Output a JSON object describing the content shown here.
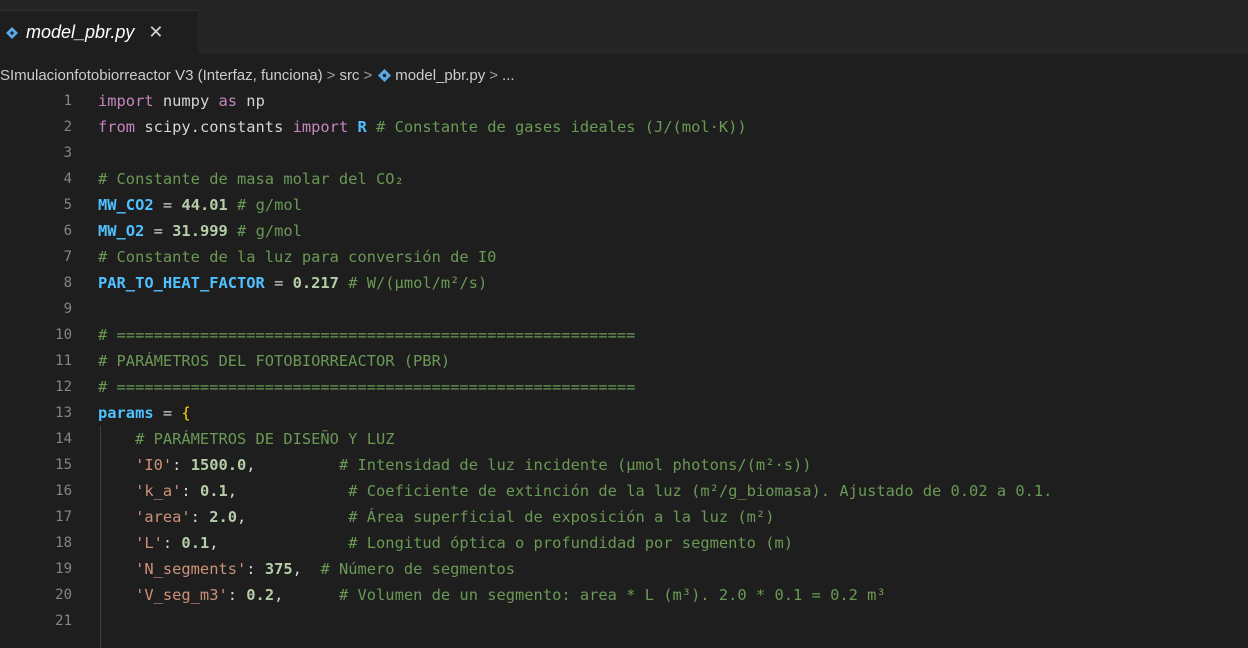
{
  "tab": {
    "label": "model_pbr.py",
    "close": "✕"
  },
  "breadcrumb": {
    "items": [
      "SImulacionfotobiorreactor V3 (Interfaz, funciona)",
      "src",
      "model_pbr.py",
      "..."
    ],
    "separator": ">"
  },
  "editor": {
    "lines": [
      {
        "n": "1",
        "segs": [
          [
            "kw",
            "import"
          ],
          [
            "wt",
            " numpy "
          ],
          [
            "kw",
            "as"
          ],
          [
            "wt",
            " np"
          ]
        ]
      },
      {
        "n": "2",
        "segs": [
          [
            "kw",
            "from"
          ],
          [
            "wt",
            " scipy.constants "
          ],
          [
            "kw",
            "import"
          ],
          [
            "var",
            " R"
          ],
          [
            "cm",
            " # Constante de gases ideales (J/(mol·K))"
          ]
        ]
      },
      {
        "n": "3",
        "segs": []
      },
      {
        "n": "4",
        "segs": [
          [
            "cm",
            "# Constante de masa molar del CO₂"
          ]
        ]
      },
      {
        "n": "5",
        "segs": [
          [
            "var",
            "MW_CO2"
          ],
          [
            "wt",
            " = "
          ],
          [
            "num",
            "44.01"
          ],
          [
            "cm",
            " # g/mol"
          ]
        ]
      },
      {
        "n": "6",
        "segs": [
          [
            "var",
            "MW_O2"
          ],
          [
            "wt",
            " = "
          ],
          [
            "num",
            "31.999"
          ],
          [
            "cm",
            " # g/mol"
          ]
        ]
      },
      {
        "n": "7",
        "segs": [
          [
            "cm",
            "# Constante de la luz para conversión de I0"
          ]
        ]
      },
      {
        "n": "8",
        "segs": [
          [
            "var",
            "PAR_TO_HEAT_FACTOR"
          ],
          [
            "wt",
            " = "
          ],
          [
            "num",
            "0.217"
          ],
          [
            "cm",
            " # W/(μmol/m²/s)"
          ]
        ]
      },
      {
        "n": "9",
        "segs": []
      },
      {
        "n": "10",
        "segs": [
          [
            "cm",
            "# ========================================================"
          ]
        ]
      },
      {
        "n": "11",
        "segs": [
          [
            "cm",
            "# PARÁMETROS DEL FOTOBIORREACTOR (PBR)"
          ]
        ]
      },
      {
        "n": "12",
        "segs": [
          [
            "cm",
            "# ========================================================"
          ]
        ]
      },
      {
        "n": "13",
        "segs": [
          [
            "var",
            "params"
          ],
          [
            "wt",
            " = "
          ],
          [
            "brace",
            "{"
          ]
        ]
      },
      {
        "n": "14",
        "segs": [
          [
            "cm",
            "    # PARÁMETROS DE DISEÑO Y LUZ"
          ]
        ]
      },
      {
        "n": "15",
        "segs": [
          [
            "str",
            "    'I0'"
          ],
          [
            "wt",
            ": "
          ],
          [
            "num",
            "1500.0"
          ],
          [
            "wt",
            ",         "
          ],
          [
            "cm",
            "# Intensidad de luz incidente (μmol photons/(m²·s))"
          ]
        ]
      },
      {
        "n": "16",
        "segs": [
          [
            "str",
            "    'k_a'"
          ],
          [
            "wt",
            ": "
          ],
          [
            "num",
            "0.1"
          ],
          [
            "wt",
            ",            "
          ],
          [
            "cm",
            "# Coeficiente de extinción de la luz (m²/g_biomasa). Ajustado de 0.02 a 0.1."
          ]
        ]
      },
      {
        "n": "17",
        "segs": [
          [
            "str",
            "    'area'"
          ],
          [
            "wt",
            ": "
          ],
          [
            "num",
            "2.0"
          ],
          [
            "wt",
            ",           "
          ],
          [
            "cm",
            "# Área superficial de exposición a la luz (m²)"
          ]
        ]
      },
      {
        "n": "18",
        "segs": [
          [
            "str",
            "    'L'"
          ],
          [
            "wt",
            ": "
          ],
          [
            "num",
            "0.1"
          ],
          [
            "wt",
            ",              "
          ],
          [
            "cm",
            "# Longitud óptica o profundidad por segmento (m)"
          ]
        ]
      },
      {
        "n": "19",
        "segs": [
          [
            "str",
            "    'N_segments'"
          ],
          [
            "wt",
            ": "
          ],
          [
            "num",
            "375"
          ],
          [
            "wt",
            ",  "
          ],
          [
            "cm",
            "# Número de segmentos"
          ]
        ]
      },
      {
        "n": "20",
        "segs": [
          [
            "str",
            "    'V_seg_m3'"
          ],
          [
            "wt",
            ": "
          ],
          [
            "num",
            "0.2"
          ],
          [
            "wt",
            ",      "
          ],
          [
            "cm",
            "# Volumen de un segmento: area * L (m³). 2.0 * 0.1 = 0.2 m³"
          ]
        ]
      },
      {
        "n": "21",
        "segs": []
      }
    ]
  },
  "colors": {
    "background": "#1e1e1e",
    "keyword": "#c586c0",
    "variable": "#4fc1ff",
    "number": "#b5cea8",
    "comment": "#6a9955",
    "string": "#ce9178",
    "brace": "#ffd700",
    "python_icon": "#5aa9e6"
  },
  "icons": {
    "file_type": "python-file-icon",
    "close": "close-icon"
  }
}
